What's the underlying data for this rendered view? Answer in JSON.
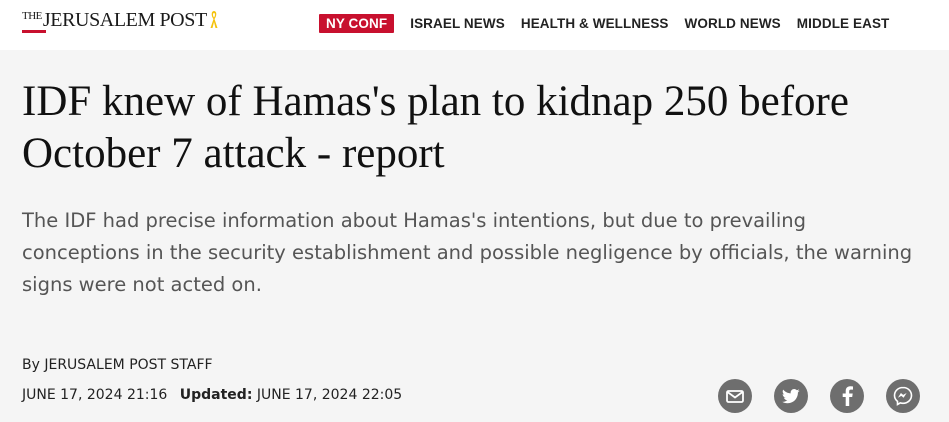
{
  "header": {
    "logo": {
      "prefix": "THE",
      "name": "JERUSALEM POST"
    },
    "nav": [
      {
        "label": "NY CONF"
      },
      {
        "label": "ISRAEL NEWS"
      },
      {
        "label": "HEALTH & WELLNESS"
      },
      {
        "label": "WORLD NEWS"
      },
      {
        "label": "MIDDLE EAST"
      }
    ]
  },
  "article": {
    "title": "IDF knew of Hamas's plan to kidnap 250 before October 7 attack - report",
    "subtitle": "The IDF had precise information about Hamas's intentions, but due to prevailing conceptions in the security establishment and possible negligence by officials, the warning signs were not acted on.",
    "byline": "By JERUSALEM POST STAFF",
    "published": "JUNE 17, 2024 21:16",
    "updated_label": "Updated:",
    "updated": "JUNE 17, 2024 22:05"
  },
  "share": {
    "icons": [
      "email-icon",
      "twitter-icon",
      "facebook-icon",
      "messenger-icon"
    ]
  },
  "colors": {
    "brand_red": "#c8102e",
    "page_background": "#f5f5f5",
    "share_icon_bg": "#6e6e6e"
  }
}
